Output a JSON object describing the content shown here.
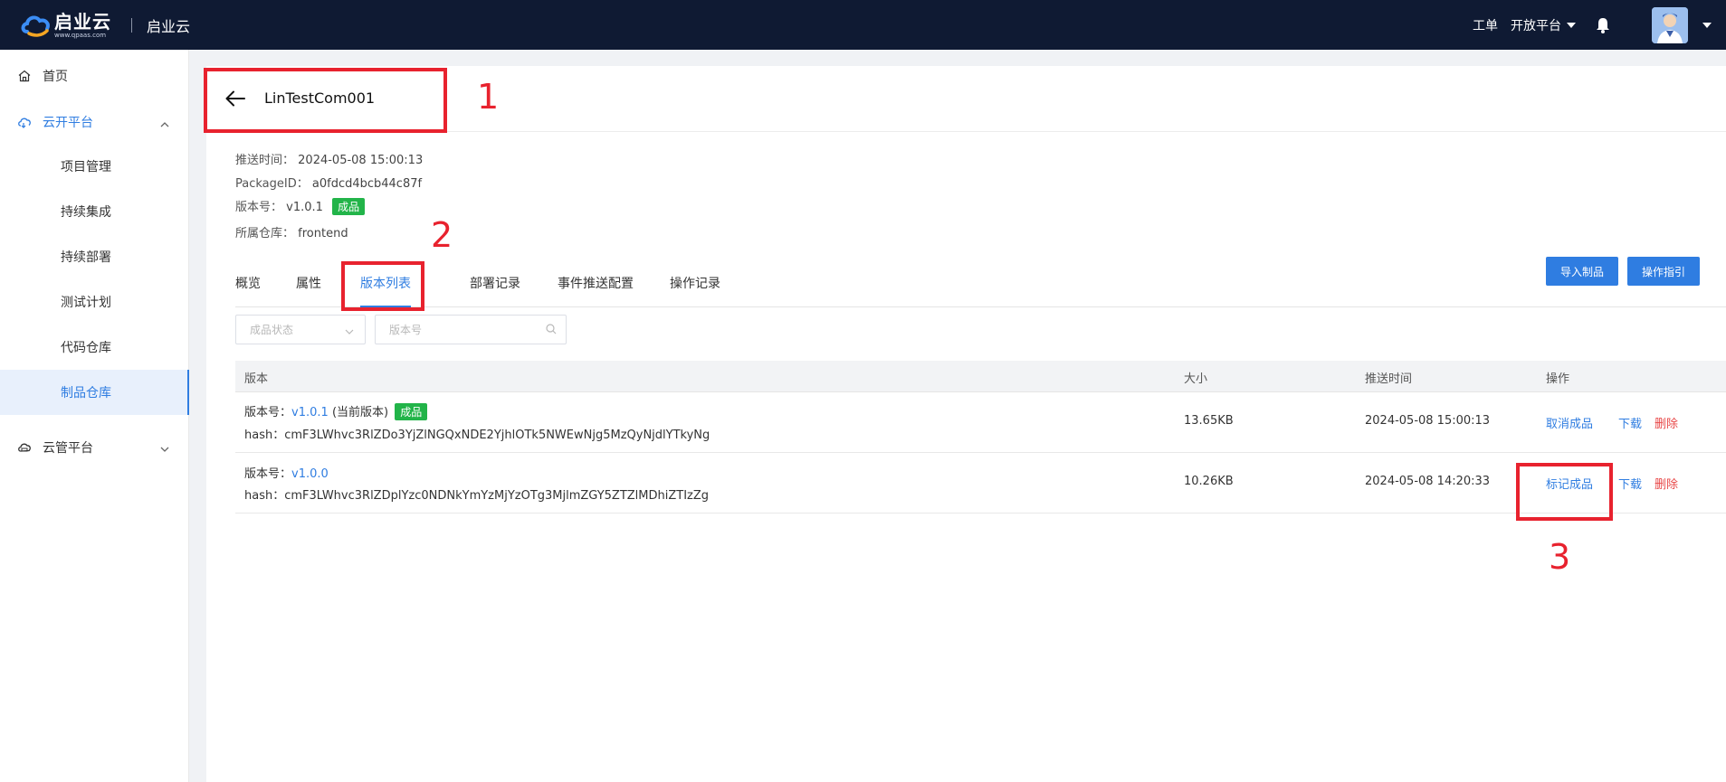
{
  "topbar": {
    "logo_title": "启业云",
    "logo_sub": "www.qpaas.com",
    "app_name": "启业云",
    "work_order": "工单",
    "open_platform": "开放平台"
  },
  "sidebar": {
    "home": "首页",
    "cloud_dev": "云开平台",
    "sub_items": [
      "项目管理",
      "持续集成",
      "持续部署",
      "测试计划",
      "代码仓库",
      "制品仓库"
    ],
    "cloud_mgmt": "云管平台"
  },
  "page": {
    "title": "LinTestCom001",
    "push_time_label": "推送时间：",
    "push_time_value": "2024-05-08 15:00:13",
    "package_id_label": "PackageID：",
    "package_id_value": "a0fdcd4bcb44c87f",
    "version_label": "版本号：",
    "version_value": "v1.0.1",
    "version_badge": "成品",
    "repo_label": "所属仓库：",
    "repo_value": "frontend"
  },
  "tabs": [
    "概览",
    "属性",
    "版本列表",
    "部署记录",
    "事件推送配置",
    "操作记录"
  ],
  "active_tab": "版本列表",
  "actions": {
    "import": "导入制品",
    "guide": "操作指引"
  },
  "filters": {
    "status_placeholder": "成品状态",
    "version_placeholder": "版本号"
  },
  "table": {
    "headers": [
      "版本",
      "大小",
      "推送时间",
      "操作"
    ],
    "rows": [
      {
        "version_prefix": "版本号：",
        "version": "v1.0.1",
        "current_note": "(当前版本)",
        "badge": "成品",
        "hash_label": "hash：",
        "hash": "cmF3LWhvc3RlZDo3YjZlNGQxNDE2YjhlOTk5NWEwNjg5MzQyNjdlYTkyNg",
        "size": "13.65KB",
        "time": "2024-05-08 15:00:13",
        "op1": "取消成品",
        "op2": "下载",
        "op3": "删除"
      },
      {
        "version_prefix": "版本号：",
        "version": "v1.0.0",
        "hash_label": "hash：",
        "hash": "cmF3LWhvc3RlZDplYzc0NDNkYmYzMjYzOTg3MjlmZGY5ZTZlMDhiZTIzZg",
        "size": "10.26KB",
        "time": "2024-05-08 14:20:33",
        "op1": "标记成品",
        "op2": "下载",
        "op3": "删除"
      }
    ]
  },
  "annotations": [
    "1",
    "2",
    "3"
  ],
  "colors": {
    "topbar": "#0f1a33",
    "accent": "#2f7de1",
    "success": "#22b449",
    "danger": "#e84848",
    "annotation": "#e8222e"
  }
}
